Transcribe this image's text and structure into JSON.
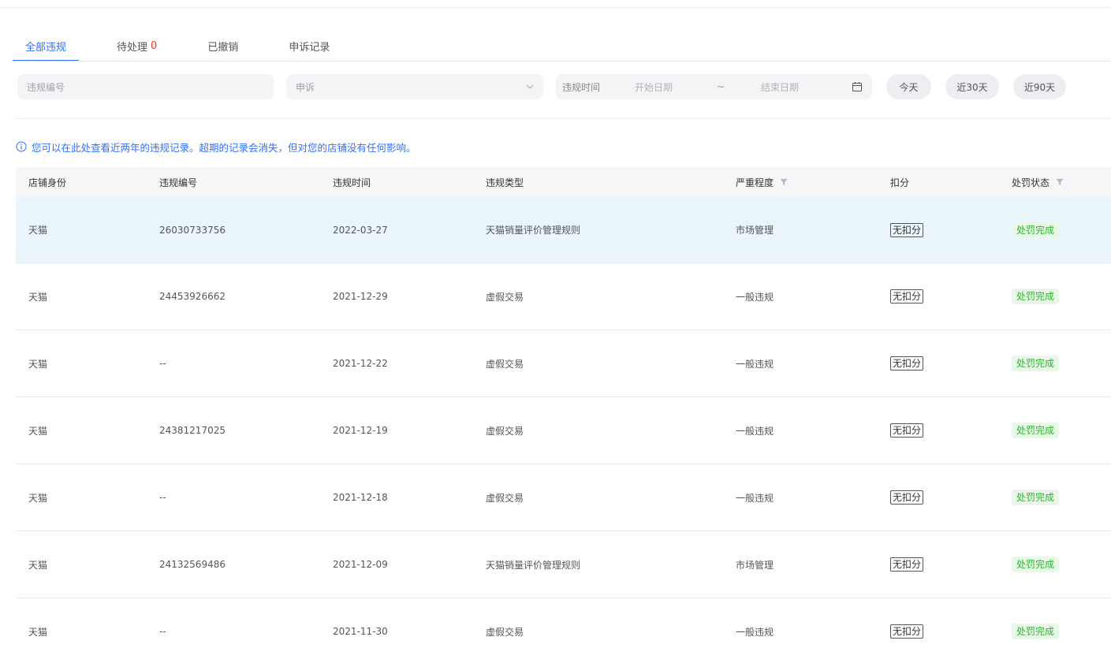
{
  "tabs": [
    {
      "label": "全部违规",
      "count": ""
    },
    {
      "label": "待处理",
      "count": "0"
    },
    {
      "label": "已撤销",
      "count": ""
    },
    {
      "label": "申诉记录",
      "count": ""
    }
  ],
  "filters": {
    "code_placeholder": "违规编号",
    "appeal_value": "申诉",
    "date_label": "违规时间",
    "start_placeholder": "开始日期",
    "separator": "~",
    "end_placeholder": "结束日期",
    "quick": [
      "今天",
      "近30天",
      "近90天"
    ]
  },
  "notice": "您可以在此处查看近两年的违规记录。超期的记录会消失，但对您的店铺没有任何影响。",
  "table": {
    "headers": [
      "店铺身份",
      "违规编号",
      "违规时间",
      "违规类型",
      "严重程度",
      "扣分",
      "处罚状态"
    ],
    "rows": [
      {
        "shop": "天猫",
        "code": "26030733756",
        "date": "2022-03-27",
        "type": "天猫销量评价管理规则",
        "severity": "市场管理",
        "deduct": "无扣分",
        "status": "处罚完成"
      },
      {
        "shop": "天猫",
        "code": "24453926662",
        "date": "2021-12-29",
        "type": "虚假交易",
        "severity": "一般违规",
        "deduct": "无扣分",
        "status": "处罚完成"
      },
      {
        "shop": "天猫",
        "code": "--",
        "date": "2021-12-22",
        "type": "虚假交易",
        "severity": "一般违规",
        "deduct": "无扣分",
        "status": "处罚完成"
      },
      {
        "shop": "天猫",
        "code": "24381217025",
        "date": "2021-12-19",
        "type": "虚假交易",
        "severity": "一般违规",
        "deduct": "无扣分",
        "status": "处罚完成"
      },
      {
        "shop": "天猫",
        "code": "--",
        "date": "2021-12-18",
        "type": "虚假交易",
        "severity": "一般违规",
        "deduct": "无扣分",
        "status": "处罚完成"
      },
      {
        "shop": "天猫",
        "code": "24132569486",
        "date": "2021-12-09",
        "type": "天猫销量评价管理规则",
        "severity": "市场管理",
        "deduct": "无扣分",
        "status": "处罚完成"
      },
      {
        "shop": "天猫",
        "code": "--",
        "date": "2021-11-30",
        "type": "虚假交易",
        "severity": "一般违规",
        "deduct": "无扣分",
        "status": "处罚完成"
      }
    ]
  },
  "colors": {
    "accent": "#3370ff",
    "pending_count": "#ff2b2b",
    "status_green": "#2fb52f",
    "highlight_row": "#eaf6fc"
  },
  "icons": {
    "info": "info-circle-icon",
    "dropdown": "chevron-down-icon",
    "calendar": "calendar-icon",
    "filter": "funnel-icon"
  }
}
